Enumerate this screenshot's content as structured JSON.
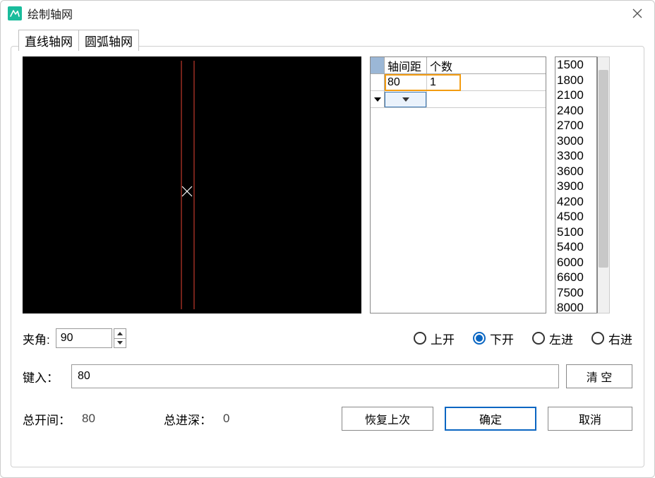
{
  "window": {
    "title": "绘制轴网"
  },
  "tabs": {
    "linear": "直线轴网",
    "arc": "圆弧轴网",
    "active": "linear"
  },
  "grid": {
    "col_span": "轴间距",
    "col_count": "个数",
    "rows": [
      {
        "span": "80",
        "count": "1"
      }
    ]
  },
  "presets": [
    "1500",
    "1800",
    "2100",
    "2400",
    "2700",
    "3000",
    "3300",
    "3600",
    "3900",
    "4200",
    "4500",
    "5100",
    "5400",
    "6000",
    "6600",
    "7500",
    "8000"
  ],
  "angle": {
    "label": "夹角:",
    "value": "90"
  },
  "direction": {
    "options": [
      {
        "key": "up",
        "label": "上开",
        "checked": false
      },
      {
        "key": "down",
        "label": "下开",
        "checked": true
      },
      {
        "key": "left",
        "label": "左进",
        "checked": false
      },
      {
        "key": "right",
        "label": "右进",
        "checked": false
      }
    ]
  },
  "entry": {
    "label": "键入：",
    "value": "80"
  },
  "buttons": {
    "clear": "清   空",
    "restore": "恢复上次",
    "ok": "确定",
    "cancel": "取消"
  },
  "summary": {
    "width_label": "总开间：",
    "width_value": "80",
    "depth_label": "总进深：",
    "depth_value": "0"
  }
}
